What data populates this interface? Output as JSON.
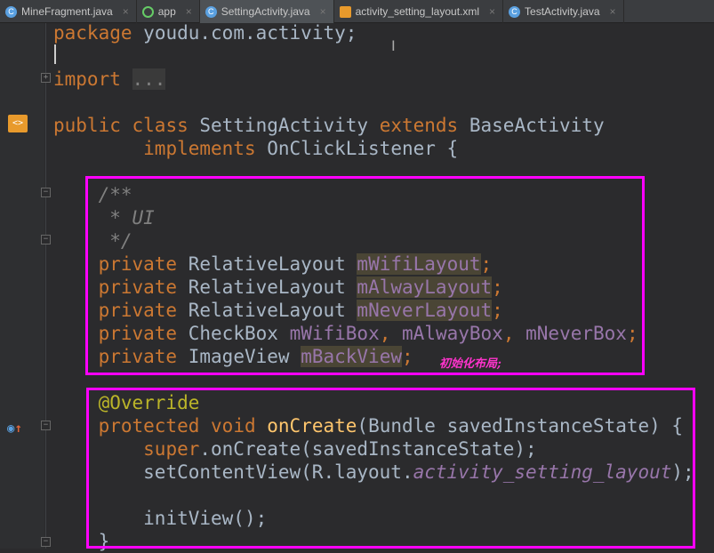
{
  "tabs": [
    {
      "label": "MineFragment.java",
      "icon": "class-icon"
    },
    {
      "label": "app",
      "icon": "android-module-icon"
    },
    {
      "label": "SettingActivity.java",
      "icon": "class-icon",
      "active": true
    },
    {
      "label": "activity_setting_layout.xml",
      "icon": "xml-layout-icon"
    },
    {
      "label": "TestActivity.java",
      "icon": "class-icon"
    }
  ],
  "code": {
    "package_kw": "package",
    "package_name": "youdu.com.activity;",
    "import_kw": "import",
    "import_fold": "...",
    "l_public": "public",
    "l_class": "class",
    "class_name": "SettingActivity",
    "l_extends": "extends",
    "base": "BaseActivity",
    "l_implements": "implements",
    "iface": "OnClickListener {",
    "c1": "/**",
    "c2": " * UI",
    "c3": " */",
    "private": "private",
    "t_rel": "RelativeLayout",
    "t_cb": "CheckBox",
    "t_iv": "ImageView",
    "f_wifi": "mWifiLayout",
    "f_alway": "mAlwayLayout",
    "f_never": "mNeverLayout",
    "f_wbox": "mWifiBox",
    "f_abox": "mAlwayBox",
    "f_nbox": "mNeverBox",
    "f_back": "mBackView",
    "override": "@Override",
    "protected": "protected",
    "void": "void",
    "oncreate": "onCreate",
    "params": "(Bundle savedInstanceState) {",
    "super": "super",
    "super_rest": ".onCreate(savedInstanceState);",
    "setcv": "setContentView(R.layout.",
    "layout_id": "activity_setting_layout",
    "setcv_end": ");",
    "initview": "initView();",
    "close": "}"
  },
  "annotation_note": "初始化布局;",
  "colors": {
    "keyword": "#cc7832",
    "field": "#9876aa",
    "highlight_box": "#ff00ff"
  }
}
